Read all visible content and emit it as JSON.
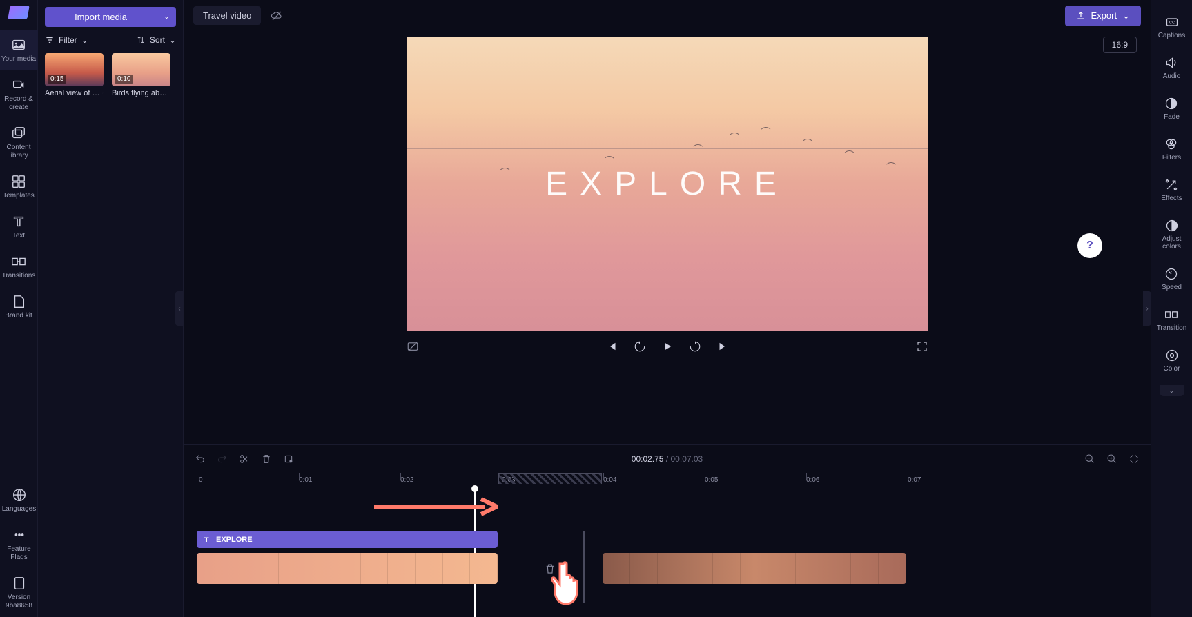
{
  "nav": {
    "items": [
      "Your media",
      "Record & create",
      "Content library",
      "Templates",
      "Text",
      "Transitions",
      "Brand kit"
    ],
    "bottom": [
      "Languages",
      "Feature Flags",
      "Version 9ba8658"
    ]
  },
  "media": {
    "import_label": "Import media",
    "filter_label": "Filter",
    "sort_label": "Sort",
    "clips": [
      {
        "duration": "0:15",
        "name": "Aerial view of …"
      },
      {
        "duration": "0:10",
        "name": "Birds flying ab…"
      }
    ]
  },
  "topbar": {
    "project_title": "Travel video",
    "export_label": "Export",
    "ratio": "16:9"
  },
  "preview": {
    "overlay_text": "EXPLORE"
  },
  "timeline": {
    "current": "00:02.75",
    "total": "00:07.03",
    "ticks": [
      "0",
      "0:01",
      "0:02",
      "0:03",
      "0:04",
      "0:05",
      "0:06",
      "0:07"
    ],
    "text_clip_label": "EXPLORE"
  },
  "right_rail": {
    "items": [
      "Captions",
      "Audio",
      "Fade",
      "Filters",
      "Effects",
      "Adjust colors",
      "Speed",
      "Transition",
      "Color"
    ]
  },
  "help": {
    "label": "?"
  }
}
